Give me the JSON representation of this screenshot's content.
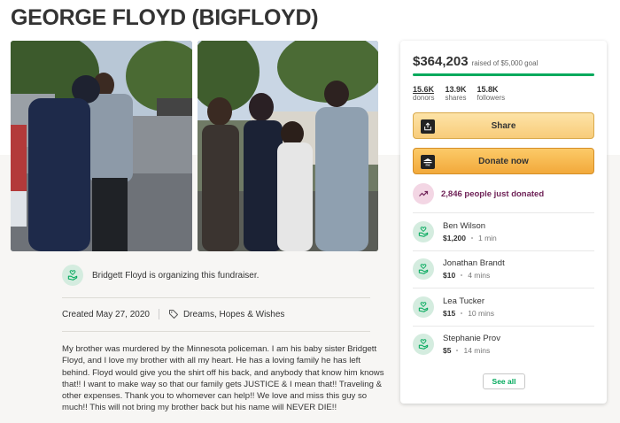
{
  "campaign": {
    "title": "GEORGE FLOYD (BIGFLOYD)"
  },
  "organizer": {
    "text": "Bridgett Floyd is organizing this fundraiser."
  },
  "meta": {
    "created": "Created May 27, 2020",
    "category": "Dreams, Hopes & Wishes"
  },
  "story": {
    "text": "My brother was murdered by the Minnesota policeman. I am his baby sister Bridgett Floyd, and I love my brother with all my heart. He has a loving family he has left behind. Floyd would give you the shirt off his back, and anybody that know him knows that!! I want to make way so that our family gets JUSTICE & I mean that!! Traveling & other expenses. Thank you to whomever can help!! We love and miss this guy so much!! This will not bring my brother back but his name will NEVER DIE!!"
  },
  "donation_panel": {
    "raised": "$364,203",
    "goal_text": "raised of $5,000 goal",
    "progress_fraction": 1.0,
    "stats": [
      {
        "value": "15.6K",
        "label": "donors"
      },
      {
        "value": "13.9K",
        "label": "shares"
      },
      {
        "value": "15.8K",
        "label": "followers"
      }
    ],
    "share_label": "Share",
    "donate_label": "Donate now",
    "recent_text": "2,846 people just donated",
    "donors": [
      {
        "name": "Ben Wilson",
        "amount": "$1,200",
        "time": "1 min"
      },
      {
        "name": "Jonathan Brandt",
        "amount": "$10",
        "time": "4 mins"
      },
      {
        "name": "Lea Tucker",
        "amount": "$15",
        "time": "10 mins"
      },
      {
        "name": "Stephanie Prov",
        "amount": "$5",
        "time": "14 mins"
      }
    ],
    "see_all_label": "See all"
  },
  "colors": {
    "accent_green": "#02a95c",
    "donate_orange": "#f2a93b",
    "share_yellow": "#f8cc7a",
    "trend_purple": "#6f2257"
  },
  "icons": {
    "share": "share-icon",
    "donate": "donate-icon",
    "trend": "trending-up-icon",
    "donor": "heart-hand-icon",
    "tag": "tag-icon"
  }
}
